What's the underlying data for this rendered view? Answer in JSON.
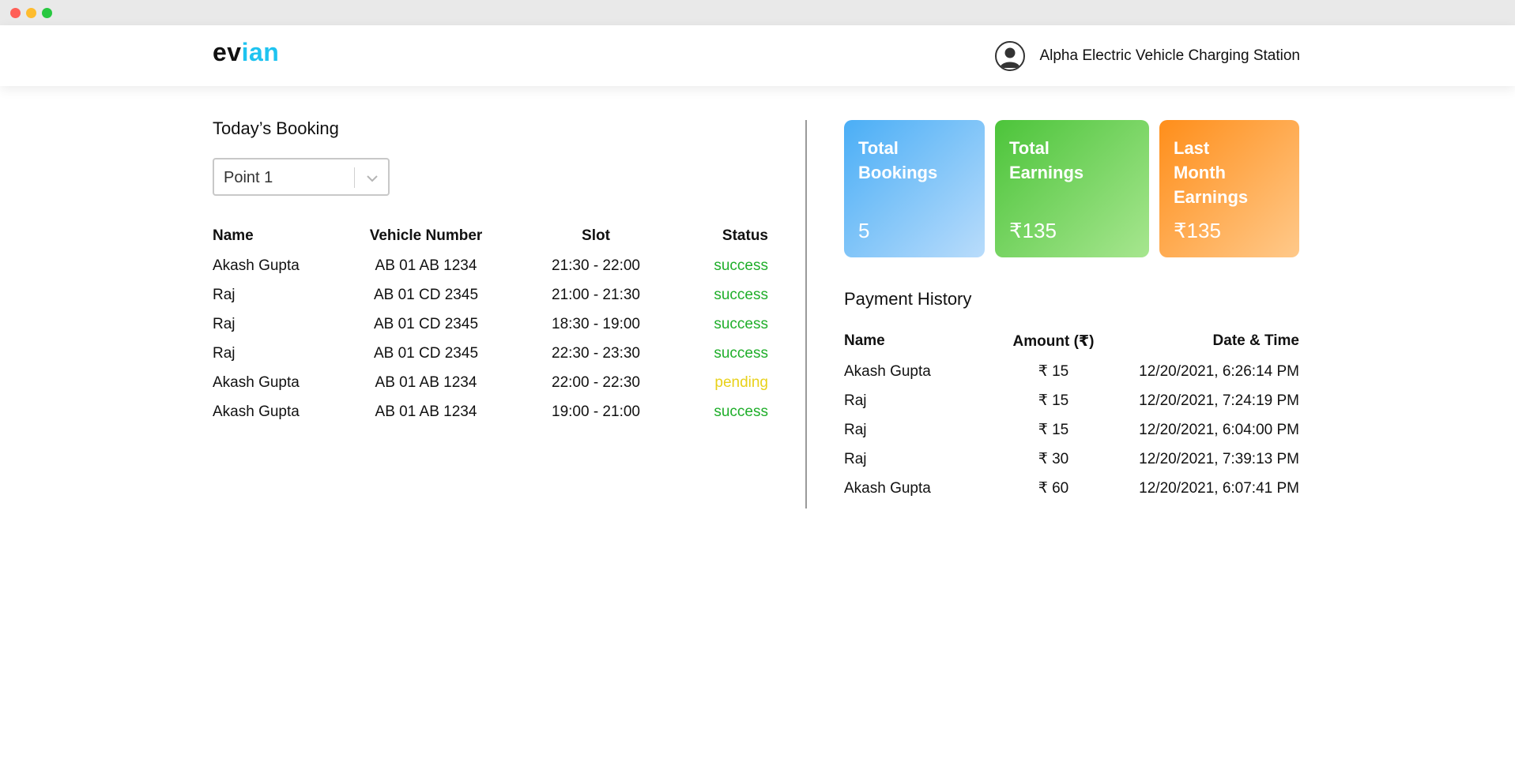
{
  "window": {
    "controls": [
      "close",
      "minimize",
      "maximize"
    ]
  },
  "header": {
    "brand_part1": "ev",
    "brand_part2": "ian",
    "brand_colors": {
      "part1": "#111111",
      "part2": "#1ec3f0"
    },
    "user_icon": "user-circle-icon",
    "station_name": "Alpha Electric Vehicle Charging Station"
  },
  "booking": {
    "title": "Today’s Booking",
    "select": {
      "value": "Point 1",
      "icon": "chevron-down-icon"
    },
    "columns": [
      "Name",
      "Vehicle Number",
      "Slot",
      "Status"
    ],
    "rows": [
      {
        "name": "Akash Gupta",
        "vehicle": "AB 01 AB 1234",
        "slot": "21:30 - 22:00",
        "status": "success"
      },
      {
        "name": "Raj",
        "vehicle": "AB 01 CD 2345",
        "slot": "21:00 - 21:30",
        "status": "success"
      },
      {
        "name": "Raj",
        "vehicle": "AB 01 CD 2345",
        "slot": "18:30 - 19:00",
        "status": "success"
      },
      {
        "name": "Raj",
        "vehicle": "AB 01 CD 2345",
        "slot": "22:30 - 23:30",
        "status": "success"
      },
      {
        "name": "Akash Gupta",
        "vehicle": "AB 01 AB 1234",
        "slot": "22:00 - 22:30",
        "status": "pending"
      },
      {
        "name": "Akash Gupta",
        "vehicle": "AB 01 AB 1234",
        "slot": "19:00 - 21:00",
        "status": "success"
      }
    ],
    "status_colors": {
      "success": "#1fae2a",
      "pending": "#e8d11a"
    }
  },
  "stats": {
    "cards": [
      {
        "title_line1": "Total",
        "title_line2": "Bookings",
        "title_line3": "",
        "value": "5",
        "color": "#4aaef6"
      },
      {
        "title_line1": "Total",
        "title_line2": "Earnings",
        "title_line3": "",
        "value": "₹135",
        "color": "#4cc43a"
      },
      {
        "title_line1": "Last",
        "title_line2": "Month",
        "title_line3": "Earnings",
        "value": "₹135",
        "color": "#ff8e1a"
      }
    ]
  },
  "payments": {
    "title": "Payment History",
    "columns": [
      "Name",
      "Amount (₹)",
      "Date & Time"
    ],
    "rows": [
      {
        "name": "Akash Gupta",
        "amount": "₹ 15",
        "datetime": "12/20/2021, 6:26:14 PM"
      },
      {
        "name": "Raj",
        "amount": "₹ 15",
        "datetime": "12/20/2021, 7:24:19 PM"
      },
      {
        "name": "Raj",
        "amount": "₹ 15",
        "datetime": "12/20/2021, 6:04:00 PM"
      },
      {
        "name": "Raj",
        "amount": "₹ 30",
        "datetime": "12/20/2021, 7:39:13 PM"
      },
      {
        "name": "Akash Gupta",
        "amount": "₹ 60",
        "datetime": "12/20/2021, 6:07:41 PM"
      }
    ]
  }
}
